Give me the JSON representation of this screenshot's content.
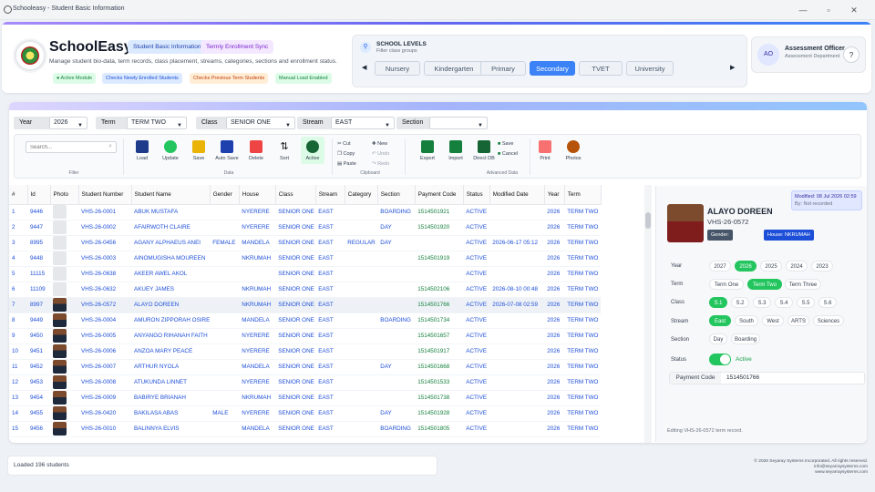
{
  "window": {
    "title": "Schooleasy - Student Basic Information",
    "minimize": "—",
    "maximize": "▫",
    "close": "✕"
  },
  "header": {
    "app_name": "SchoolEasy",
    "tag_module": "Student Basic Information",
    "tag_sync": "Termly Enrollment Sync",
    "subtitle": "Manage student bio-data, term records, class placement, streams, categories, sections and enrollment status.",
    "chips": [
      "● Active Module",
      "Checks Newly Enrolled Students",
      "Checks Previous Term Students",
      "Manual Load Enabled"
    ]
  },
  "levels": {
    "title": "SCHOOL LEVELS",
    "subtitle": "Filter class groups",
    "items": [
      "Nursery",
      "Kindergarten",
      "Primary",
      "Secondary",
      "TVET",
      "University"
    ],
    "active": "Secondary",
    "prev": "◀",
    "next": "▶"
  },
  "officer": {
    "initials": "AO",
    "name": "Assessment Officer",
    "dept": "Assessment Department",
    "help": "?"
  },
  "filters": {
    "year_label": "Year",
    "year": "2026",
    "term_label": "Term",
    "term": "TERM TWO",
    "class_label": "Class",
    "class": "SENIOR ONE",
    "stream_label": "Stream",
    "stream": "EAST",
    "section_label": "Section",
    "section": ""
  },
  "ribbon": {
    "search_placeholder": "Search...",
    "filter_group": "Filter",
    "data_group": "Data",
    "clipboard_group": "Clipboard",
    "advanced_group": "Advanced Data",
    "buttons": {
      "load": "Load",
      "update": "Update",
      "save": "Save",
      "autosave": "Auto Save",
      "delete": "Delete",
      "sort": "Sort",
      "active": "Active",
      "cut": "Cut",
      "copy": "Copy",
      "paste": "Paste",
      "new": "New",
      "undo": "Undo",
      "redo": "Redo",
      "export": "Export",
      "import": "Import",
      "directdb": "Direct DB",
      "save2": "Save",
      "cancel": "Cancel",
      "print": "Print",
      "photos": "Photos"
    }
  },
  "table": {
    "headers": [
      "#",
      "Id",
      "Photo",
      "Student Number",
      "Student Name",
      "Gender",
      "House",
      "Class",
      "Stream",
      "Category",
      "Section",
      "Payment Code",
      "Status",
      "Modified Date",
      "Year",
      "Term"
    ],
    "rows": [
      [
        "1",
        "9446",
        "",
        "VHS-26-0001",
        "ABUK MUSTAFA",
        "",
        "NYERERE",
        "SENIOR ONE",
        "EAST",
        "",
        "BOARDING",
        "1514501921",
        "ACTIVE",
        "",
        "2026",
        "TERM TWO"
      ],
      [
        "2",
        "9447",
        "",
        "VHS-26-0002",
        "AFAIRWOTH CLAIRE",
        "",
        "NYERERE",
        "SENIOR ONE",
        "EAST",
        "",
        "DAY",
        "1514501920",
        "ACTIVE",
        "",
        "2026",
        "TERM TWO"
      ],
      [
        "3",
        "8995",
        "",
        "VHS-26-0456",
        "AGANY ALPHAEUS ANEI",
        "FEMALE",
        "MANDELA",
        "SENIOR ONE",
        "EAST",
        "REGULAR",
        "DAY",
        "",
        "ACTIVE",
        "2026-06-17 05:12",
        "2026",
        "TERM TWO"
      ],
      [
        "4",
        "9448",
        "",
        "VHS-26-0003",
        "AINOMUGISHA MOUREEN",
        "",
        "NKRUMAH",
        "SENIOR ONE",
        "EAST",
        "",
        "",
        "1514501919",
        "ACTIVE",
        "",
        "2026",
        "TERM TWO"
      ],
      [
        "5",
        "11115",
        "",
        "VHS-26-0638",
        "AKEER AWEL AKOL",
        "",
        "",
        "SENIOR ONE",
        "EAST",
        "",
        "",
        "",
        "ACTIVE",
        "",
        "2026",
        "TERM TWO"
      ],
      [
        "6",
        "11109",
        "",
        "VHS-26-0632",
        "AKUEY JAMES",
        "",
        "NKRUMAH",
        "SENIOR ONE",
        "EAST",
        "",
        "",
        "1514502106",
        "ACTIVE",
        "2026-08-10 00:48",
        "2026",
        "TERM TWO"
      ],
      [
        "7",
        "8997",
        "p",
        "VHS-26-0572",
        "ALAYO DOREEN",
        "",
        "NKRUMAH",
        "SENIOR ONE",
        "EAST",
        "",
        "",
        "1514501766",
        "ACTIVE",
        "2026-07-08 02:59",
        "2026",
        "TERM TWO"
      ],
      [
        "8",
        "9449",
        "p",
        "VHS-26-0004",
        "AMURON ZIPPORAH OSIRE",
        "",
        "MANDELA",
        "SENIOR ONE",
        "EAST",
        "",
        "BOARDING",
        "1514501734",
        "ACTIVE",
        "",
        "2026",
        "TERM TWO"
      ],
      [
        "9",
        "9450",
        "p",
        "VHS-26-0005",
        "ANYANGO RIHANAH FAITH",
        "",
        "NYERERE",
        "SENIOR ONE",
        "EAST",
        "",
        "",
        "1514501657",
        "ACTIVE",
        "",
        "2026",
        "TERM TWO"
      ],
      [
        "10",
        "9451",
        "p",
        "VHS-26-0006",
        "ANZOA MARY PEACE",
        "",
        "NYERERE",
        "SENIOR ONE",
        "EAST",
        "",
        "",
        "1514501917",
        "ACTIVE",
        "",
        "2026",
        "TERM TWO"
      ],
      [
        "11",
        "9452",
        "p",
        "VHS-26-0007",
        "ARTHUR NYOLA",
        "",
        "MANDELA",
        "SENIOR ONE",
        "EAST",
        "",
        "DAY",
        "1514501668",
        "ACTIVE",
        "",
        "2026",
        "TERM TWO"
      ],
      [
        "12",
        "9453",
        "p",
        "VHS-26-0008",
        "ATUKUNDA LINNET",
        "",
        "NYERERE",
        "SENIOR ONE",
        "EAST",
        "",
        "",
        "1514501533",
        "ACTIVE",
        "",
        "2026",
        "TERM TWO"
      ],
      [
        "13",
        "9454",
        "p",
        "VHS-26-0009",
        "BABIRYE BRIANAH",
        "",
        "NKRUMAH",
        "SENIOR ONE",
        "EAST",
        "",
        "",
        "1514501738",
        "ACTIVE",
        "",
        "2026",
        "TERM TWO"
      ],
      [
        "14",
        "9455",
        "p",
        "VHS-26-0420",
        "BAKILASA ABAS",
        "MALE",
        "NYERERE",
        "SENIOR ONE",
        "EAST",
        "",
        "DAY",
        "1514501928",
        "ACTIVE",
        "",
        "2026",
        "TERM TWO"
      ],
      [
        "15",
        "9456",
        "p",
        "VHS-26-0010",
        "BALINNYA ELVIS",
        "",
        "MANDELA",
        "SENIOR ONE",
        "EAST",
        "",
        "BOARDING",
        "1514501805",
        "ACTIVE",
        "",
        "2026",
        "TERM TWO"
      ]
    ]
  },
  "detail": {
    "name": "ALAYO DOREEN",
    "number": "VHS-26-0572",
    "gender": "Gender:",
    "house": "House: NKRUMAH",
    "modified": "Modified: 08 Jul 2026 02:59",
    "by": "By: Not recorded",
    "year_label": "Year",
    "years": [
      "2027",
      "2026",
      "2025",
      "2024",
      "2023"
    ],
    "year_active": "2026",
    "term_label": "Term",
    "terms": [
      "Term One",
      "Term Two",
      "Term Three"
    ],
    "term_active": "Term Two",
    "class_label": "Class",
    "classes": [
      "S.1",
      "S.2",
      "S.3",
      "S.4",
      "S.5",
      "S.6"
    ],
    "class_active": "S.1",
    "stream_label": "Stream",
    "streams": [
      "East",
      "South",
      "West",
      "ARTS",
      "Sciences"
    ],
    "stream_active": "East",
    "section_label": "Section",
    "sections": [
      "Day",
      "Boarding"
    ],
    "status_label": "Status",
    "status_value": "Active",
    "payment_label": "Payment Code",
    "payment_value": "1514501766",
    "editing": "Editing VHS-26-0572 term record."
  },
  "footer": {
    "status": "Loaded 196 students",
    "copyright": "© 2026 Seyaray Systems Incorporated. All rights reserved.",
    "email": "info@seyarraysystems.com",
    "website": "www.seyarraysystems.com"
  }
}
